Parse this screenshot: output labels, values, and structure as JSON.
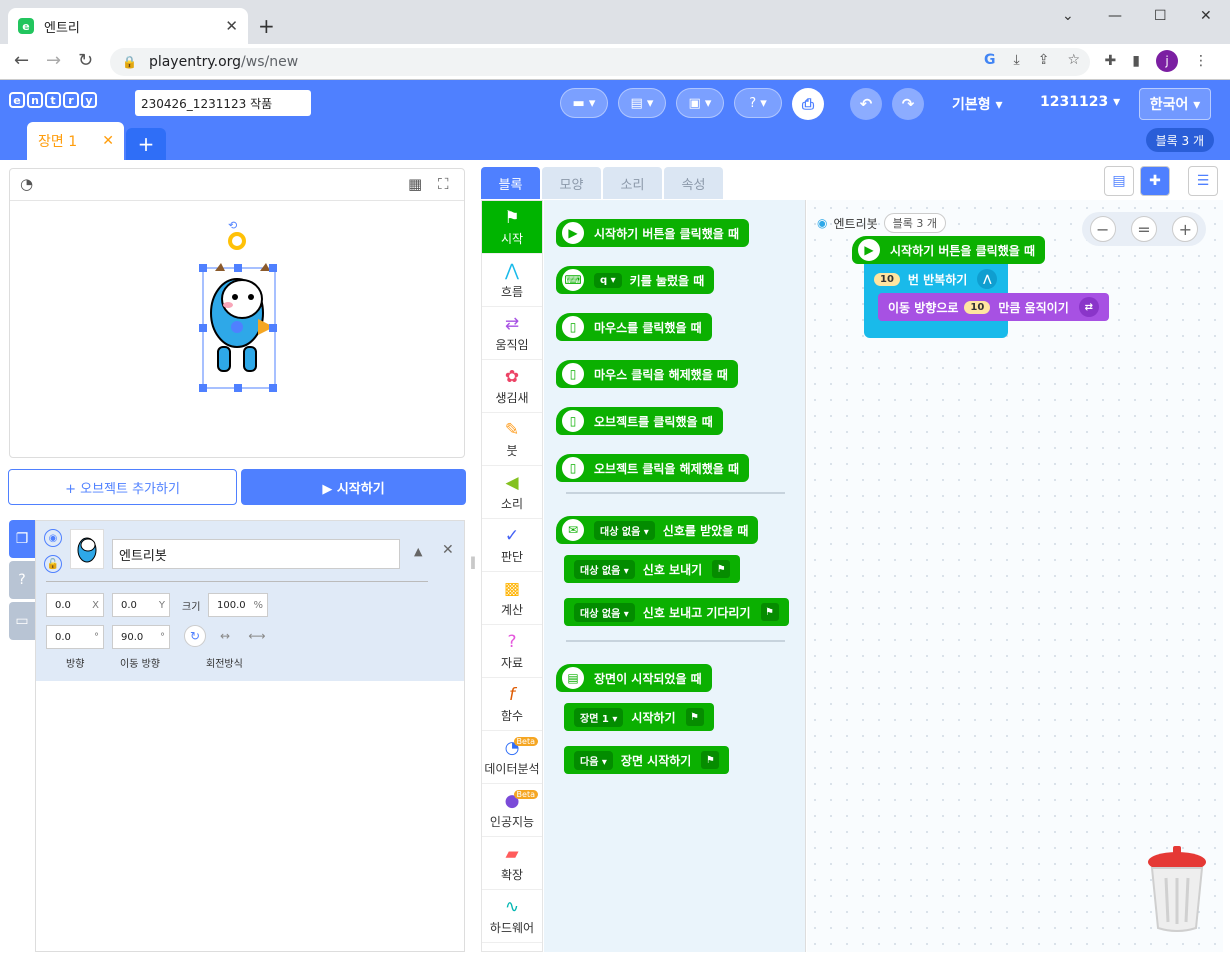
{
  "browser": {
    "tab_title": "엔트리",
    "tab_favicon": "e",
    "url_domain": "playentry.org",
    "url_path": "/ws/new",
    "profile_initial": "j"
  },
  "toolbar": {
    "logo_letters": [
      "e",
      "n",
      "t",
      "r",
      "y"
    ],
    "project_name": "230426_1231123 작품",
    "mode_label": "기본형 ▾",
    "user_label": "1231123 ▾",
    "language_label": "한국어 ▾",
    "help_label": "? ▾"
  },
  "scene": {
    "tab_label": "장면 1",
    "block_count": "블록 3 개"
  },
  "stage": {
    "add_object_label": "+ 오브젝트 추가하기",
    "start_label": "▶ 시작하기"
  },
  "object": {
    "name": "엔트리봇",
    "x": "0.0",
    "y": "0.0",
    "x_unit": "X",
    "y_unit": "Y",
    "size_label": "크기",
    "size": "100.0",
    "size_unit": "%",
    "direction": "0.0",
    "move_direction": "90.0",
    "degree_unit": "°",
    "direction_label": "방향",
    "move_direction_label": "이동 방향",
    "rotation_label": "회전방식"
  },
  "block_tabs": [
    "블록",
    "모양",
    "소리",
    "속성"
  ],
  "categories": [
    {
      "label": "시작",
      "icon": "flag-icon"
    },
    {
      "label": "흐름",
      "icon": "flow-icon"
    },
    {
      "label": "움직임",
      "icon": "arrows-icon"
    },
    {
      "label": "생김새",
      "icon": "looks-icon"
    },
    {
      "label": "붓",
      "icon": "brush-icon"
    },
    {
      "label": "소리",
      "icon": "speaker-icon"
    },
    {
      "label": "판단",
      "icon": "check-icon"
    },
    {
      "label": "계산",
      "icon": "calc-icon"
    },
    {
      "label": "자료",
      "icon": "question-icon"
    },
    {
      "label": "함수",
      "icon": "function-icon"
    },
    {
      "label": "데이터분석",
      "icon": "pie-icon",
      "beta": "Beta"
    },
    {
      "label": "인공지능",
      "icon": "ai-icon",
      "beta": "Beta"
    },
    {
      "label": "확장",
      "icon": "extension-icon"
    },
    {
      "label": "하드웨어",
      "icon": "hardware-icon"
    }
  ],
  "palette": {
    "b1": "시작하기 버튼을 클릭했을 때",
    "b2_key": "q ▾",
    "b2": "키를 눌렀을 때",
    "b3": "마우스를 클릭했을 때",
    "b4": "마우스 클릭을 해제했을 때",
    "b5": "오브젝트를 클릭했을 때",
    "b6": "오브젝트 클릭을 해제했을 때",
    "signal_none": "대상 없음 ▾",
    "b7": "신호를 받았을 때",
    "b8": "신호 보내기",
    "b9": "신호 보내고 기다리기",
    "b10": "장면이 시작되었을 때",
    "scene_drop": "장면 1 ▾",
    "b11": "시작하기",
    "next_drop": "다음 ▾",
    "b12": "장면 시작하기"
  },
  "workspace": {
    "object_name": "엔트리봇",
    "block_count": "블록 3 개",
    "start_block": "시작하기 버튼을 클릭했을 때",
    "repeat_num": "10",
    "repeat_label": "번 반복하기",
    "move_prefix": "이동 방향으로",
    "move_num": "10",
    "move_suffix": "만큼 움직이기"
  },
  "colors": {
    "brand": "#4f80ff",
    "start_green": "#0bb001",
    "flow_teal": "#19baea",
    "motion_purple": "#a751e3",
    "scene_orange": "#ff9d0c"
  }
}
